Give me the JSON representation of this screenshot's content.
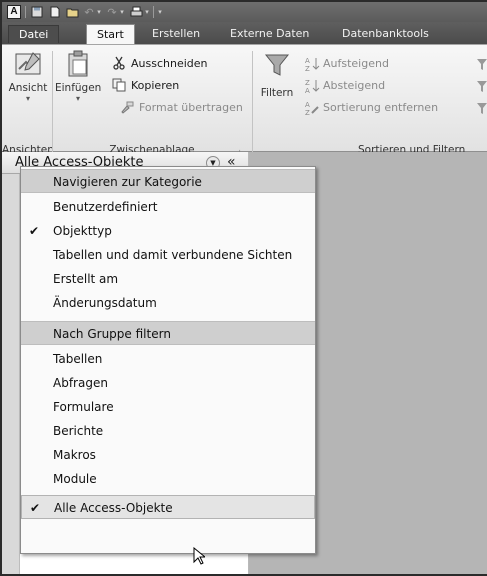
{
  "titlebar": {
    "app_icon_letter": "A"
  },
  "tabs": [
    {
      "label": "Datei"
    },
    {
      "label": "Start"
    },
    {
      "label": "Erstellen"
    },
    {
      "label": "Externe Daten"
    },
    {
      "label": "Datenbanktools"
    }
  ],
  "ribbon": {
    "groups": {
      "ansichten": "Ansichten",
      "zwischenablage": "Zwischenablage",
      "sortieren": "Sortieren und Filtern"
    },
    "ansicht_label": "Ansicht",
    "einfuegen_label": "Einfügen",
    "ausschneiden_label": "Ausschneiden",
    "kopieren_label": "Kopieren",
    "format_label": "Format übertragen",
    "filtern_label": "Filtern",
    "aufsteigend_label": "Aufsteigend",
    "absteigend_label": "Absteigend",
    "sortierung_label": "Sortierung entfernen"
  },
  "nav": {
    "title": "Alle Access-Objekte",
    "collapse_glyph": "«"
  },
  "menu": {
    "items": [
      {
        "label": "Navigieren zur Kategorie",
        "kind": "header"
      },
      {
        "label": "Benutzerdefiniert",
        "kind": "item"
      },
      {
        "label": "Objekttyp",
        "kind": "item",
        "checked": true
      },
      {
        "label": "Tabellen und damit verbundene Sichten",
        "kind": "item"
      },
      {
        "label": "Erstellt am",
        "kind": "item"
      },
      {
        "label": "Änderungsdatum",
        "kind": "item"
      },
      {
        "label": "Nach Gruppe filtern",
        "kind": "header"
      },
      {
        "label": "Tabellen",
        "kind": "item"
      },
      {
        "label": "Abfragen",
        "kind": "item"
      },
      {
        "label": "Formulare",
        "kind": "item"
      },
      {
        "label": "Berichte",
        "kind": "item"
      },
      {
        "label": "Makros",
        "kind": "item"
      },
      {
        "label": "Module",
        "kind": "item"
      },
      {
        "label": "Alle Access-Objekte",
        "kind": "item",
        "checked": true,
        "selected": true
      }
    ]
  },
  "colors": {
    "titlebar": "#5b5b5b",
    "ribbon": "#f0f0f0",
    "menu_header": "#cfcfcf",
    "workspace": "#b5b5b5"
  }
}
